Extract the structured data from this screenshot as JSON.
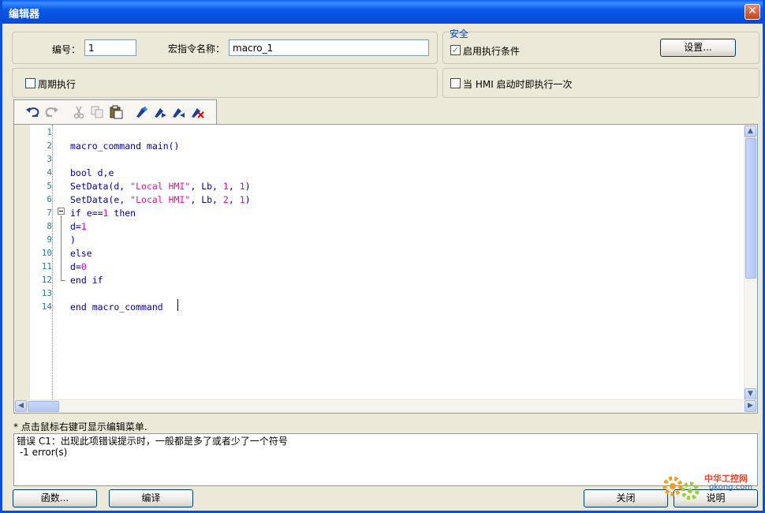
{
  "window": {
    "title": "编辑器"
  },
  "header": {
    "id_label": "编号：",
    "id_value": "1",
    "macro_name_label": "宏指令名称：",
    "macro_name_value": "macro_1",
    "periodic_label": "周期执行",
    "periodic_checked": false
  },
  "security": {
    "legend": "安全",
    "enable_condition_label": "启用执行条件",
    "enable_condition_checked": true,
    "settings_button": "设置...",
    "run_on_start_label": "当 HMI 启动时即执行一次",
    "run_on_start_checked": false
  },
  "toolbar": {
    "icons": [
      "undo-icon",
      "redo-icon",
      "cut-icon",
      "copy-icon",
      "paste-icon",
      "bookmark-toggle-icon",
      "bookmark-next-icon",
      "bookmark-prev-icon",
      "bookmark-clear-icon"
    ]
  },
  "editor": {
    "lines": [
      {
        "n": "1",
        "segments": []
      },
      {
        "n": "2",
        "segments": [
          {
            "t": "macro_command main()",
            "c": "kw"
          }
        ]
      },
      {
        "n": "3",
        "segments": []
      },
      {
        "n": "4",
        "segments": [
          {
            "t": "bool d,e",
            "c": "kw"
          }
        ]
      },
      {
        "n": "5",
        "segments": [
          {
            "t": "SetData(d, ",
            "c": "kw"
          },
          {
            "t": "\"Local HMI\"",
            "c": "str"
          },
          {
            "t": ", Lb, ",
            "c": "kw"
          },
          {
            "t": "1",
            "c": "num"
          },
          {
            "t": ", ",
            "c": "kw"
          },
          {
            "t": "1",
            "c": "num"
          },
          {
            "t": ")",
            "c": "kw"
          }
        ]
      },
      {
        "n": "6",
        "segments": [
          {
            "t": "SetData(e, ",
            "c": "kw"
          },
          {
            "t": "\"Local HMI\"",
            "c": "str"
          },
          {
            "t": ", Lb, ",
            "c": "kw"
          },
          {
            "t": "2",
            "c": "num"
          },
          {
            "t": ", ",
            "c": "kw"
          },
          {
            "t": "1",
            "c": "num"
          },
          {
            "t": ")",
            "c": "kw"
          }
        ]
      },
      {
        "n": "7",
        "segments": [
          {
            "t": "if e==",
            "c": "kw"
          },
          {
            "t": "1",
            "c": "num"
          },
          {
            "t": " then",
            "c": "kw"
          }
        ]
      },
      {
        "n": "8",
        "segments": [
          {
            "t": "d=",
            "c": "kw"
          },
          {
            "t": "1",
            "c": "num"
          }
        ]
      },
      {
        "n": "9",
        "segments": [
          {
            "t": ")",
            "c": "kw"
          }
        ]
      },
      {
        "n": "10",
        "segments": [
          {
            "t": "else",
            "c": "kw"
          }
        ]
      },
      {
        "n": "11",
        "segments": [
          {
            "t": "d=",
            "c": "kw"
          },
          {
            "t": "0",
            "c": "num"
          }
        ]
      },
      {
        "n": "12",
        "segments": [
          {
            "t": "end if",
            "c": "kw"
          }
        ]
      },
      {
        "n": "13",
        "segments": []
      },
      {
        "n": "14",
        "segments": [
          {
            "t": "end macro_command",
            "c": "kw"
          }
        ]
      }
    ]
  },
  "hint": "* 点击鼠标右键可显示编辑菜单.",
  "output": {
    "line1": "错误 C1：出现此项错误提示时，一般都是多了或者少了一个符号",
    "line2": " -1 error(s)"
  },
  "buttons": {
    "functions": "函数...",
    "compile": "编译",
    "close": "关闭",
    "help": "说明"
  },
  "watermark": {
    "brand": "中华工控网",
    "domain": "gkong.com"
  },
  "colors": {
    "title_bar": "#0a5ae8",
    "keyword": "#0000a0",
    "string": "#e0178f",
    "number": "#e000e0"
  }
}
